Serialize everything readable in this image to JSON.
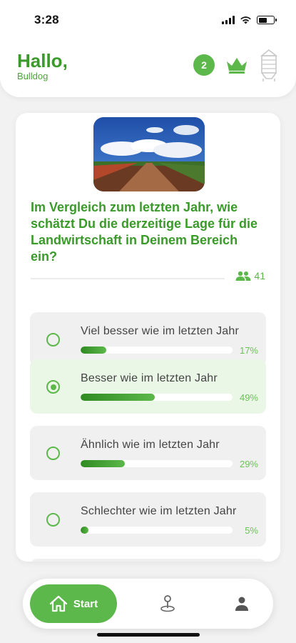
{
  "status": {
    "time": "3:28"
  },
  "header": {
    "greeting": "Hallo,",
    "username": "Bulldog",
    "badge_count": "2"
  },
  "poll": {
    "question": "Im Vergleich zum letzten Jahr, wie schätzt Du die derzeitige Lage für die Landwirtschaft in Deinem Bereich ein?",
    "votes": "41",
    "options": [
      {
        "label": "Viel besser wie im letzten Jahr",
        "percent_text": "17%",
        "percent": 17,
        "selected": false
      },
      {
        "label": "Besser wie im letzten Jahr",
        "percent_text": "49%",
        "percent": 49,
        "selected": true
      },
      {
        "label": "Ähnlich wie im letzten Jahr",
        "percent_text": "29%",
        "percent": 29,
        "selected": false
      },
      {
        "label": "Schlechter wie im letzten Jahr",
        "percent_text": "5%",
        "percent": 5,
        "selected": false
      }
    ]
  },
  "nav": {
    "start_label": "Start"
  },
  "colors": {
    "accent": "#5cb84a",
    "accent_dark": "#3a9a2a",
    "selected_bg": "#eaf6e6"
  },
  "icons": [
    "signal-icon",
    "wifi-icon",
    "battery-icon",
    "crown-icon",
    "silo-icon",
    "people-icon",
    "home-icon",
    "map-pin-icon",
    "profile-icon"
  ]
}
